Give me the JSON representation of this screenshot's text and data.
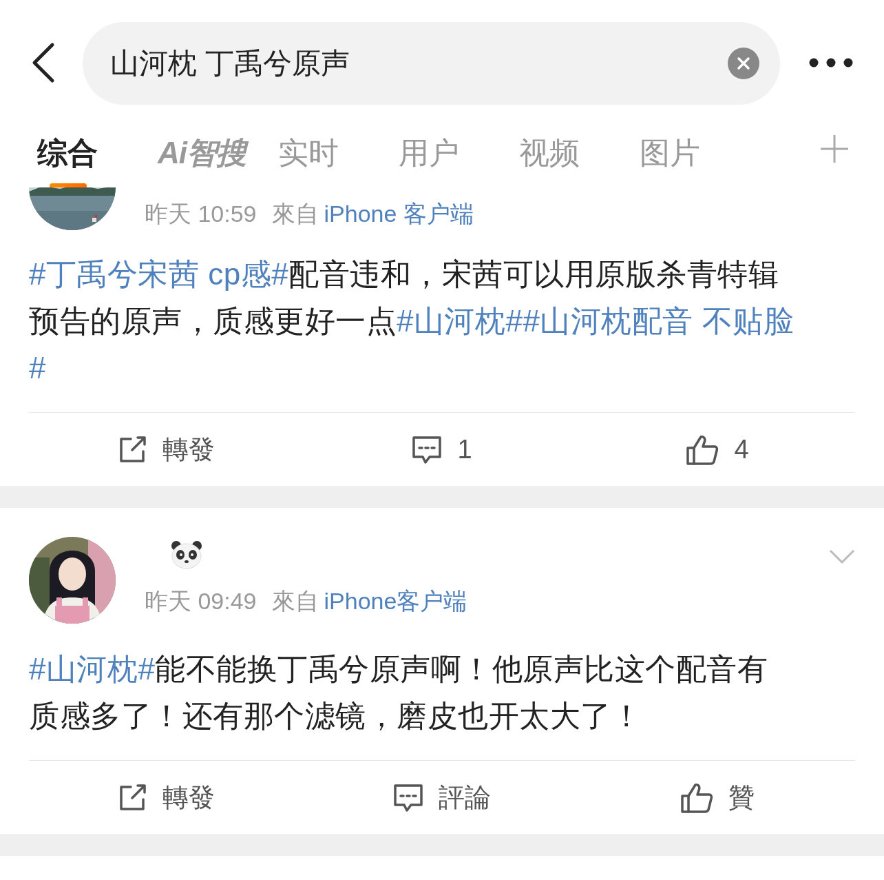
{
  "search": {
    "value": "山河枕 丁禹兮原声"
  },
  "tabs": [
    {
      "label": "综合",
      "selected": true
    },
    {
      "label": "Ai智搜",
      "kind": "logo",
      "selected": false
    },
    {
      "label": "实时",
      "selected": false
    },
    {
      "label": "用户",
      "selected": false
    },
    {
      "label": "视频",
      "selected": false
    },
    {
      "label": "图片",
      "selected": false
    }
  ],
  "posts": [
    {
      "avatar_clipped": true,
      "has_name": false,
      "time": "昨天 10:59",
      "source_prefix": "來自",
      "source": "iPhone 客户端",
      "menu": false,
      "lines": [
        [
          {
            "text": "#丁禹兮宋茜 cp感#",
            "kind": "topic"
          },
          {
            "text": "配音违和，宋茜可以用原版杀青特辑",
            "kind": "plain"
          }
        ],
        [
          {
            "text": "预告的原声，质感更好一点",
            "kind": "plain"
          },
          {
            "text": "#山河枕#",
            "kind": "topic"
          },
          {
            "text": "#山河枕配音 不贴脸",
            "kind": "topic"
          }
        ],
        [
          {
            "text": "#",
            "kind": "topic"
          }
        ]
      ],
      "actions": [
        {
          "kind": "repost",
          "label": "轉發"
        },
        {
          "kind": "comment",
          "label": "1"
        },
        {
          "kind": "like",
          "label": "4"
        }
      ]
    },
    {
      "avatar_clipped": false,
      "has_name": true,
      "time": "昨天 09:49",
      "source_prefix": "來自",
      "source": "iPhone客户端",
      "menu": true,
      "lines": [
        [
          {
            "text": "#山河枕#",
            "kind": "topic"
          },
          {
            "text": "能不能换丁禹兮原声啊！他原声比这个配音有",
            "kind": "plain"
          }
        ],
        [
          {
            "text": "质感多了！还有那个滤镜，磨皮也开太大了！",
            "kind": "plain"
          }
        ]
      ],
      "actions": [
        {
          "kind": "repost",
          "label": "轉發"
        },
        {
          "kind": "comment",
          "label": "評論"
        },
        {
          "kind": "like",
          "label": "贊"
        }
      ]
    }
  ]
}
